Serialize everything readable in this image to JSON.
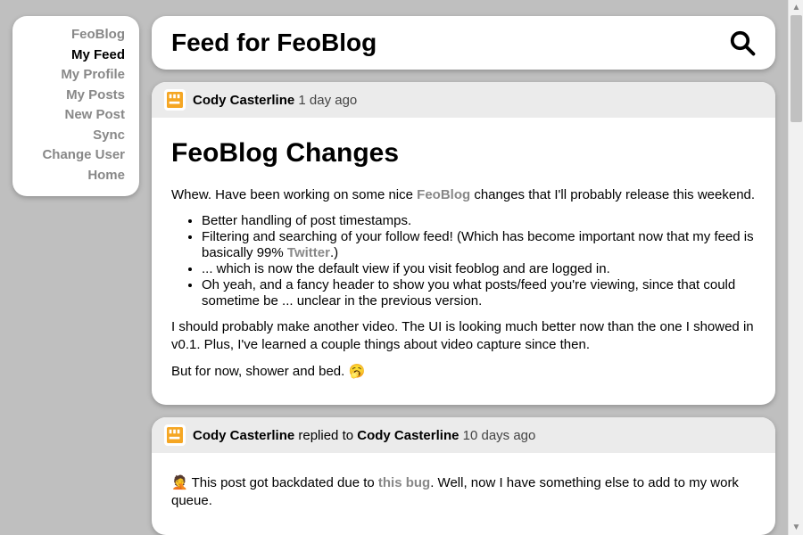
{
  "sidebar": {
    "items": [
      {
        "label": "FeoBlog",
        "active": false
      },
      {
        "label": "My Feed",
        "active": true
      },
      {
        "label": "My Profile",
        "active": false
      },
      {
        "label": "My Posts",
        "active": false
      },
      {
        "label": "New Post",
        "active": false
      },
      {
        "label": "Sync",
        "active": false
      },
      {
        "label": "Change User",
        "active": false
      },
      {
        "label": "Home",
        "active": false
      }
    ]
  },
  "header": {
    "title": "Feed for FeoBlog"
  },
  "posts": [
    {
      "author": "Cody Casterline",
      "byline_suffix": "",
      "time": "1 day ago",
      "title": "FeoBlog Changes",
      "intro_before": "Whew. Have been working on some nice ",
      "intro_link": "FeoBlog",
      "intro_after": " changes that I'll probably release this weekend.",
      "bullets": [
        "Better handling of post timestamps.",
        {
          "before": "Filtering and searching of your follow feed! (Which has become important now that my feed is basically 99% ",
          "link": "Twitter",
          "after": ".)"
        },
        "... which is now the default view if you visit feoblog and are logged in.",
        "Oh yeah, and a fancy header to show you what posts/feed you're viewing, since that could sometime be ... unclear in the previous version."
      ],
      "para2": "I should probably make another video. The UI is looking much better now than the one I showed in v0.1. Plus, I've learned a couple things about video capture since then.",
      "para3": "But for now, shower and bed. 🥱"
    },
    {
      "author": "Cody Casterline",
      "byline_mid": " replied to ",
      "reply_to": "Cody Casterline",
      "time": "10 days ago",
      "reply_before": "🤦 This post got backdated due to ",
      "reply_link": "this bug",
      "reply_after": ". Well, now I have something else to add to my work queue."
    }
  ]
}
